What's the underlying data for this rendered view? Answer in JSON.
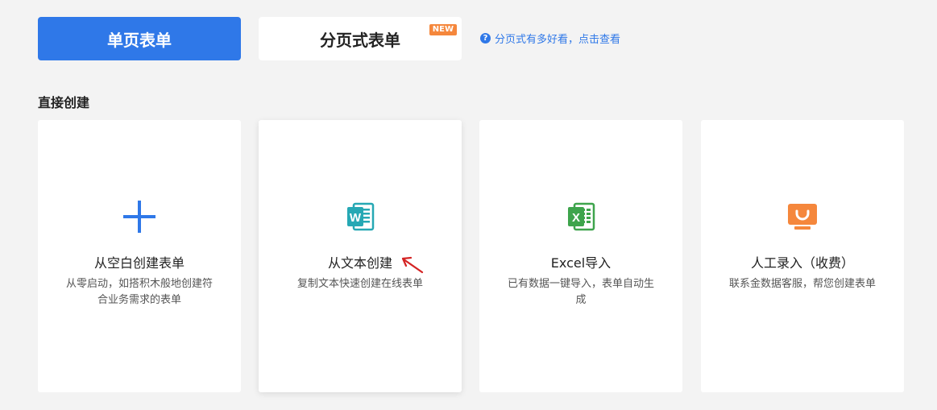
{
  "tabs": {
    "single": "单页表单",
    "paged": "分页式表单",
    "new_badge": "NEW"
  },
  "help_link": {
    "icon": "?",
    "text": "分页式有多好看，点击查看"
  },
  "section_title": "直接创建",
  "cards": [
    {
      "icon": "plus-icon",
      "title": "从空白创建表单",
      "desc": "从零启动，如搭积木般地创建符合业务需求的表单"
    },
    {
      "icon": "word-icon",
      "title": "从文本创建",
      "desc": "复制文本快速创建在线表单"
    },
    {
      "icon": "excel-icon",
      "title": "Excel导入",
      "desc": "已有数据一键导入，表单自动生成"
    },
    {
      "icon": "support-monitor-icon",
      "title": "人工录入（收费）",
      "desc": "联系金数据客服，帮您创建表单"
    }
  ],
  "colors": {
    "primary": "#2f78e8",
    "badge": "#f5873c",
    "word": "#26a8b4",
    "excel": "#3ea44c",
    "support": "#f5873c",
    "arrow": "#d42424"
  }
}
